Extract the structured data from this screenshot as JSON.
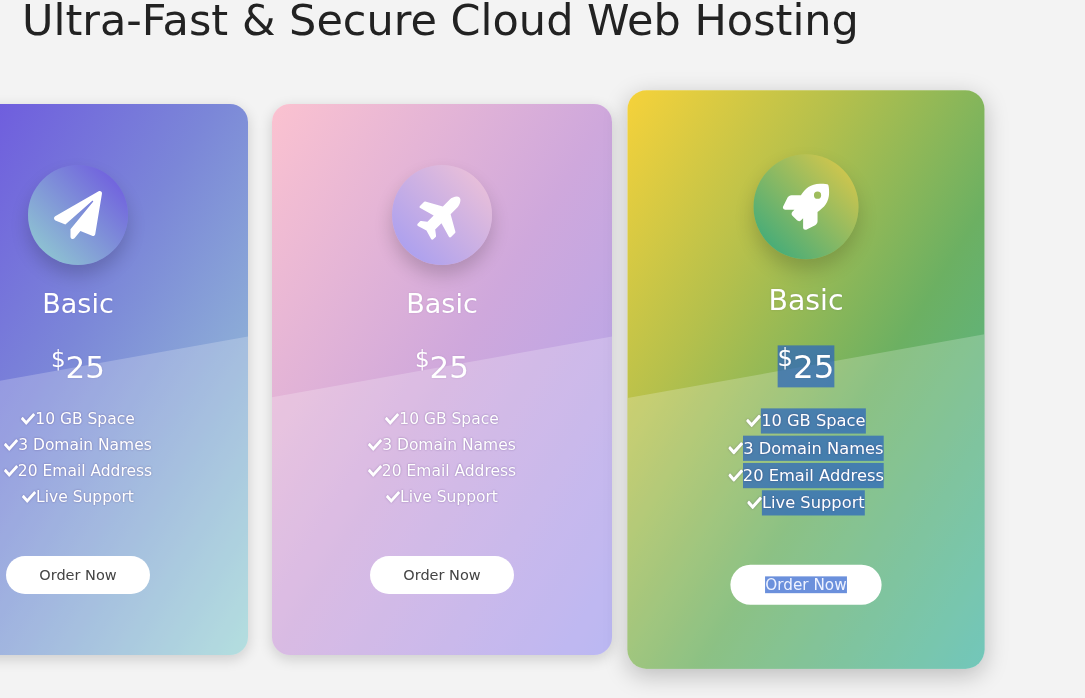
{
  "title": "Ultra-Fast & Secure Cloud Web Hosting",
  "cards": [
    {
      "plan": "Basic",
      "currency": "$",
      "amount": "25",
      "features": [
        "10 GB Space",
        "3 Domain Names",
        "20 Email Address",
        "Live Support"
      ],
      "button": "Order Now",
      "raised": false,
      "text_selected": false
    },
    {
      "plan": "Basic",
      "currency": "$",
      "amount": "25",
      "features": [
        "10 GB Space",
        "3 Domain Names",
        "20 Email Address",
        "Live Support"
      ],
      "button": "Order Now",
      "raised": false,
      "text_selected": false
    },
    {
      "plan": "Basic",
      "currency": "$",
      "amount": "25",
      "features": [
        "10 GB Space",
        "3 Domain Names",
        "20 Email Address",
        "Live Support"
      ],
      "button": "Order Now",
      "raised": true,
      "text_selected": true
    }
  ]
}
